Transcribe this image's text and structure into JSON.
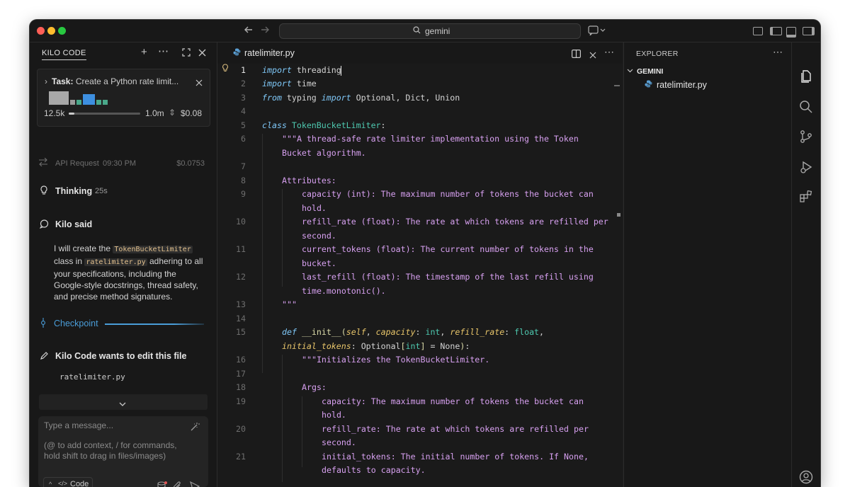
{
  "titlebar": {
    "search_text": "gemini"
  },
  "chat": {
    "title": "KILO CODE",
    "task": {
      "label": "Task:",
      "text": "Create a Python rate limit...",
      "tokens_in": "12.5k",
      "tokens_max": "1.0m",
      "cost": "$0.08"
    },
    "api_request": {
      "label": "API Request",
      "time": "09:30 PM",
      "cost": "$0.0753"
    },
    "thinking": {
      "label": "Thinking",
      "duration": "25s"
    },
    "kilo_said": {
      "label": "Kilo said",
      "text_1": "I will create the ",
      "chip_1": "TokenBucketLimiter",
      "text_2": " class in ",
      "chip_2": "ratelimiter.py",
      "text_3": " adhering to all your specifications, including the Google-style docstrings, thread safety, and precise method signatures."
    },
    "checkpoint": "Checkpoint",
    "edit": {
      "label": "Kilo Code wants to edit this file",
      "file": "ratelimiter.py"
    },
    "input": {
      "placeholder_1": "Type a message...",
      "placeholder_2": "(@ to add context, / for commands, hold shift to drag in files/images)",
      "mode": "Code"
    }
  },
  "editor": {
    "tab_label": "ratelimiter.py",
    "line_numbers": [
      "1",
      "2",
      "3",
      "4",
      "5",
      "6",
      "7",
      "8",
      "9",
      "10",
      "11",
      "12",
      "13",
      "14",
      "15",
      "16",
      "17",
      "18",
      "19",
      "20",
      "21"
    ]
  },
  "explorer": {
    "title": "EXPLORER",
    "folder": "GEMINI",
    "file": "ratelimiter.py"
  },
  "colors": {
    "accent_blue": "#4a9dd8",
    "keyword": "#c586c0",
    "string": "#d7a0f0",
    "class": "#4ec9b0"
  }
}
